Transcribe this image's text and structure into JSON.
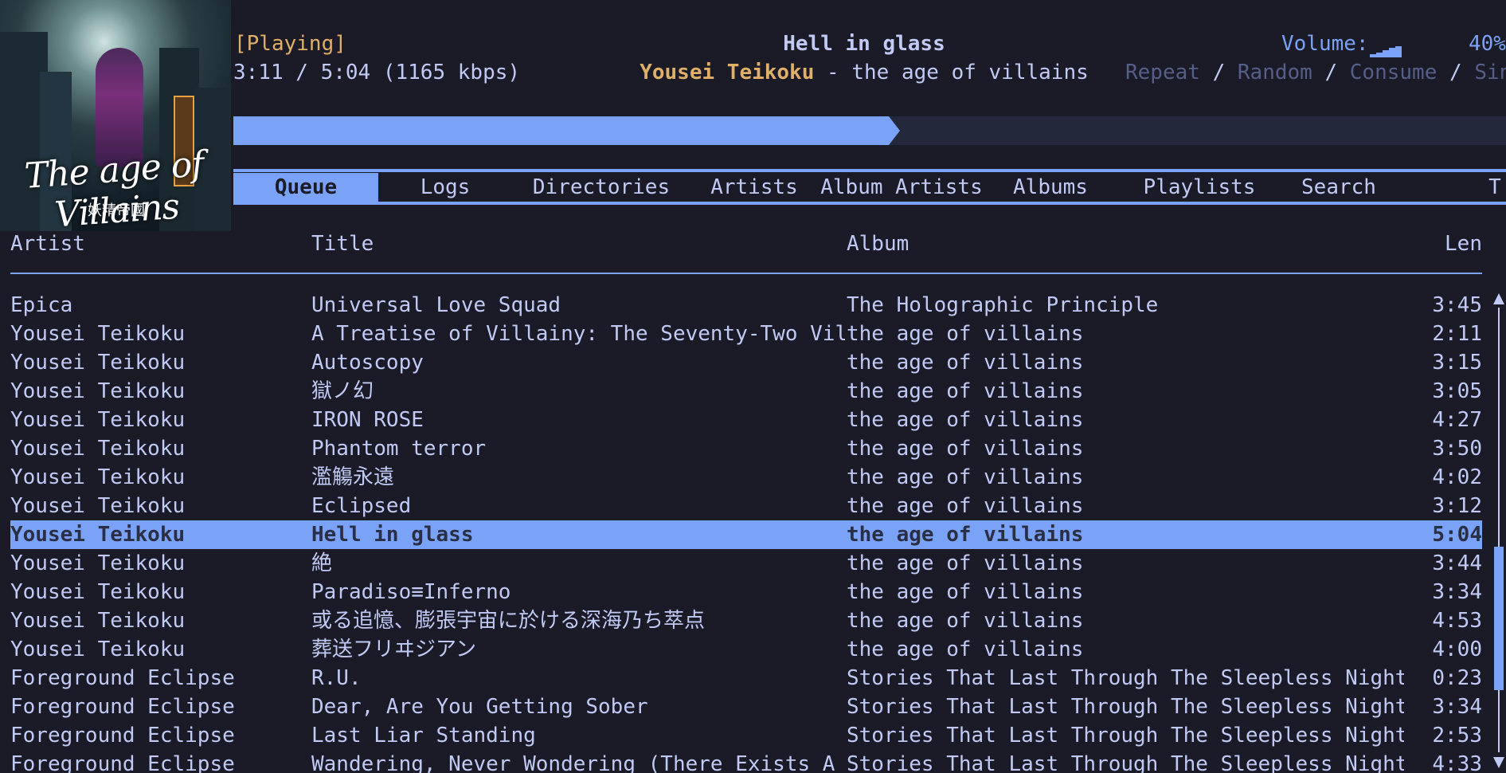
{
  "album_art": {
    "title_text": "The age of Villains",
    "subtitle_text": "妖精帝國"
  },
  "status": {
    "state": "[Playing]",
    "elapsed": "3:11 / 5:04 (1165 kbps)",
    "progress": 0.515
  },
  "song": {
    "title": "Hell in glass",
    "artist": "Yousei Teikoku",
    "separator": " - ",
    "album": "the age of villains"
  },
  "volume": {
    "label": "Volume:",
    "value": "40%",
    "level": 0.4
  },
  "modes": {
    "repeat": "Repeat",
    "random": "Random",
    "consume": "Consume",
    "single": "Single",
    "separator": " / "
  },
  "tabs": [
    {
      "label": "Queue",
      "active": true
    },
    {
      "label": "Logs"
    },
    {
      "label": "Directories"
    },
    {
      "label": "Artists"
    },
    {
      "label": "Album Artists"
    },
    {
      "label": "Albums"
    },
    {
      "label": "Playlists"
    },
    {
      "label": "Search"
    },
    {
      "label": "T"
    }
  ],
  "table": {
    "columns": [
      "Artist",
      "Title",
      "Album",
      "Len"
    ],
    "selected_index": 8,
    "rows": [
      [
        "Epica",
        "Universal Love Squad",
        "The Holographic Principle",
        "3:45"
      ],
      [
        "Yousei Teikoku",
        "A Treatise of Villainy: The Seventy-Two Vill...",
        "the age of villains",
        "2:11"
      ],
      [
        "Yousei Teikoku",
        "Autoscopy",
        "the age of villains",
        "3:15"
      ],
      [
        "Yousei Teikoku",
        "獄ノ幻",
        "the age of villains",
        "3:05"
      ],
      [
        "Yousei Teikoku",
        "IRON ROSE",
        "the age of villains",
        "4:27"
      ],
      [
        "Yousei Teikoku",
        "Phantom terror",
        "the age of villains",
        "3:50"
      ],
      [
        "Yousei Teikoku",
        "濫觴永遠",
        "the age of villains",
        "4:02"
      ],
      [
        "Yousei Teikoku",
        "Eclipsed",
        "the age of villains",
        "3:12"
      ],
      [
        "Yousei Teikoku",
        "Hell in glass",
        "the age of villains",
        "5:04"
      ],
      [
        "Yousei Teikoku",
        "絶",
        "the age of villains",
        "3:44"
      ],
      [
        "Yousei Teikoku",
        "Paradiso≡Inferno",
        "the age of villains",
        "3:34"
      ],
      [
        "Yousei Teikoku",
        "或る追憶、膨張宇宙に於ける深海乃ち萃点",
        "the age of villains",
        "4:53"
      ],
      [
        "Yousei Teikoku",
        "葬送フリヰジアン",
        "the age of villains",
        "4:00"
      ],
      [
        "Foreground Eclipse",
        "R.U.",
        "Stories That Last Through The Sleepless Nights",
        "0:23"
      ],
      [
        "Foreground Eclipse",
        "Dear, Are You Getting Sober",
        "Stories That Last Through The Sleepless Nights",
        "3:34"
      ],
      [
        "Foreground Eclipse",
        "Last Liar Standing",
        "Stories That Last Through The Sleepless Nights",
        "2:53"
      ],
      [
        "Foreground Eclipse",
        "Wandering, Never Wondering (There Exists A S...",
        "Stories That Last Through The Sleepless Nights",
        "4:33"
      ]
    ]
  },
  "colors": {
    "background": "#1a1b26",
    "accent": "#7aa2f7",
    "highlight": "#e0af68",
    "text": "#c0caf5",
    "muted": "#565f89"
  }
}
